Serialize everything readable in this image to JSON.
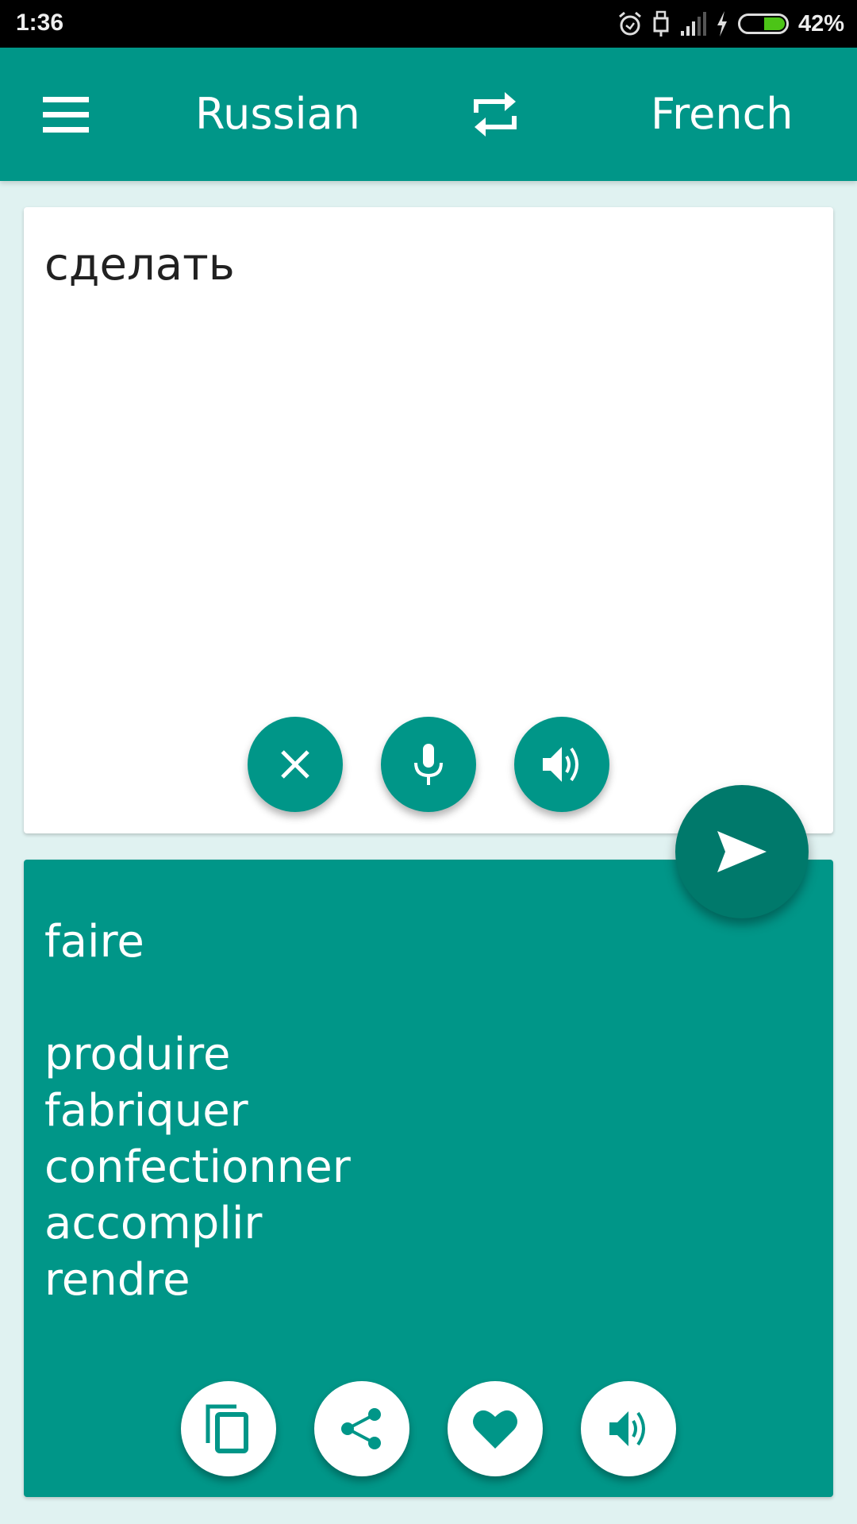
{
  "status_bar": {
    "time": "1:36",
    "battery_percent": "42%",
    "icons": [
      "alarm-icon",
      "usb-icon",
      "signal-icon",
      "charging-icon",
      "battery-icon"
    ]
  },
  "toolbar": {
    "menu_icon": "hamburger-menu-icon",
    "source_language": "Russian",
    "swap_icon": "swap-languages-icon",
    "target_language": "French"
  },
  "input": {
    "text": "сделать",
    "buttons": [
      {
        "name": "clear",
        "icon": "close-icon"
      },
      {
        "name": "voice-input",
        "icon": "microphone-icon"
      },
      {
        "name": "speak-input",
        "icon": "volume-icon"
      }
    ]
  },
  "translate_button": {
    "icon": "send-icon"
  },
  "output": {
    "primary": "faire",
    "alternatives": [
      "produire",
      "fabriquer",
      "confectionner",
      "accomplir",
      "rendre"
    ],
    "buttons": [
      {
        "name": "copy",
        "icon": "copy-icon"
      },
      {
        "name": "share",
        "icon": "share-icon"
      },
      {
        "name": "favorite",
        "icon": "heart-icon"
      },
      {
        "name": "speak-output",
        "icon": "volume-icon"
      }
    ]
  },
  "colors": {
    "primary": "#009688",
    "primary_dark": "#00796B",
    "background": "#E0F2F1"
  }
}
